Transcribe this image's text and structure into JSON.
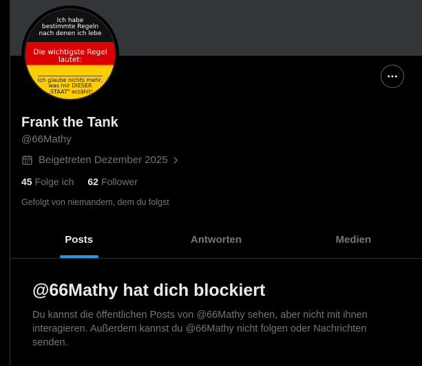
{
  "profile": {
    "avatar_lines": {
      "top": [
        "Ich habe",
        "bestimmte Regeln",
        "nach denen ich lebe"
      ],
      "middle": [
        "Die wichtigste Regel",
        "lautet:"
      ],
      "bottom": [
        "Ich glaube nichts mehr,",
        "was mir DIESER",
        "„STAAT\" erzählt!"
      ]
    },
    "name": "Frank the Tank",
    "handle": "@66Mathy",
    "joined": "Beigetreten Dezember 2025",
    "following_count": "45",
    "following_label": "Folge ich",
    "followers_count": "62",
    "followers_label": "Follower",
    "followed_by": "Gefolgt von niemandem, dem du folgst"
  },
  "tabs": [
    {
      "label": "Posts",
      "active": true
    },
    {
      "label": "Antworten",
      "active": false
    },
    {
      "label": "Medien",
      "active": false
    }
  ],
  "blocked": {
    "title": "@66Mathy hat dich blockiert",
    "text": "Du kannst die öffentlichen Posts von @66Mathy sehen, aber nicht mit ihnen interagieren. Außerdem kannst du @66Mathy nicht folgen oder Nachrichten senden."
  },
  "colors": {
    "background": "#000000",
    "banner": "#333639",
    "accent": "#1d9bf0",
    "secondary_text": "#71767b",
    "primary_text": "#e7e9ea"
  },
  "icons": {
    "more": "more-horizontal-icon",
    "calendar": "calendar-icon",
    "chevron": "chevron-right-icon"
  }
}
